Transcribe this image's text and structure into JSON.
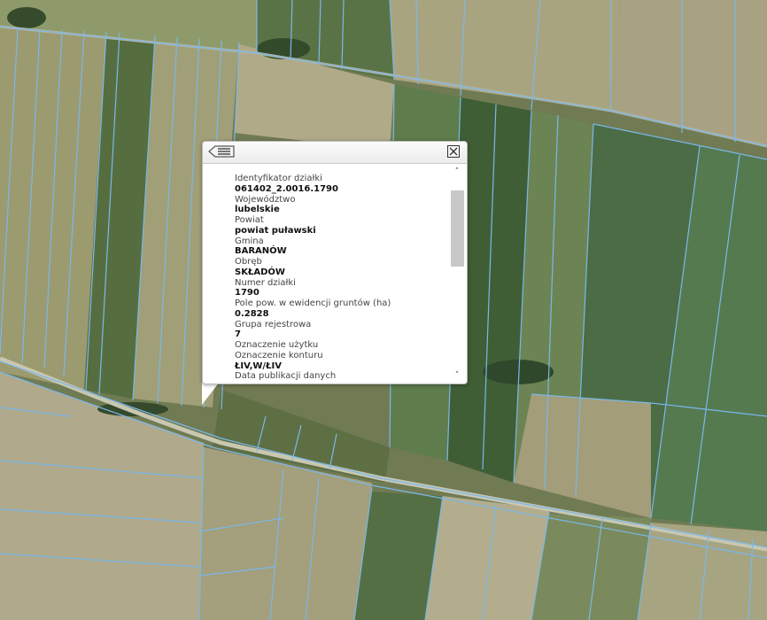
{
  "map": {
    "background_color": "#707b54",
    "parcel_line_color": "#7ab8ea",
    "field_colors": [
      "#8a8e62",
      "#4f6b3d",
      "#9d9a70",
      "#5f7a4a",
      "#a8a584",
      "#3f5e38",
      "#b3ad8e",
      "#6b7f52"
    ]
  },
  "popup": {
    "list_icon": "list-icon",
    "close_icon": "close-icon",
    "rows": [
      {
        "label": "Identyfikator działki",
        "value": "061402_2.0016.1790"
      },
      {
        "label": "Województwo",
        "value": "lubelskie"
      },
      {
        "label": "Powiat",
        "value": "powiat puławski"
      },
      {
        "label": "Gmina",
        "value": "BARANÓW"
      },
      {
        "label": "Obręb",
        "value": "SKŁADÓW"
      },
      {
        "label": "Numer działki",
        "value": "1790"
      },
      {
        "label": "Pole pow. w ewidencji gruntów (ha)",
        "value": "0.2828"
      },
      {
        "label": "Grupa rejestrowa",
        "value": "7"
      },
      {
        "label": "Oznaczenie użytku",
        "value": ""
      },
      {
        "label": "Oznaczenie konturu",
        "value": "ŁIV,W/ŁIV"
      },
      {
        "label": "Data publikacji danych",
        "value": ""
      }
    ],
    "scroll_up_glyph": "˄",
    "scroll_down_glyph": "˅"
  }
}
